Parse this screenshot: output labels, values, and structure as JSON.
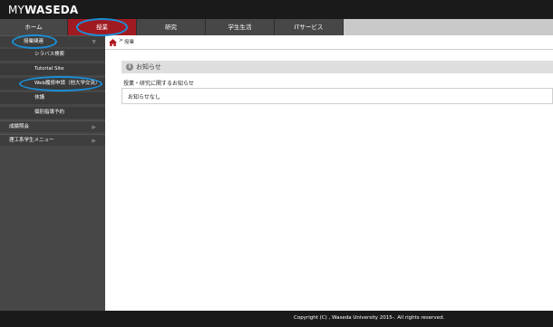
{
  "header": {
    "logo_my": "MY",
    "logo_waseda": "WASEDA"
  },
  "tabs": [
    {
      "label": "ホーム",
      "active": false
    },
    {
      "label": "授業",
      "active": true
    },
    {
      "label": "研究",
      "active": false
    },
    {
      "label": "学生生活",
      "active": false
    },
    {
      "label": "ITサービス",
      "active": false
    }
  ],
  "sidebar": {
    "items": [
      {
        "label": "授業関連",
        "type": "parent",
        "expanded": true
      },
      {
        "label": "シラバス検索",
        "type": "child"
      },
      {
        "label": "Tutorial Site",
        "type": "child"
      },
      {
        "label": "Web履修申請（他大学交流）",
        "type": "child"
      },
      {
        "label": "休講",
        "type": "child"
      },
      {
        "label": "個別指導予約",
        "type": "child"
      },
      {
        "label": "成績照会",
        "type": "parent",
        "expanded": false
      },
      {
        "label": "理工系学生メニュー",
        "type": "parent",
        "expanded": false
      }
    ]
  },
  "breadcrumb": {
    "separator": ">",
    "current": "授業"
  },
  "notice": {
    "icon": "info-icon",
    "title": "お知らせ",
    "subtitle": "授業・研究に関するお知らせ",
    "body": "お知らせなし"
  },
  "footer": {
    "copyright": "Copyright (C) , Waseda University 2015-. All rights reserved."
  },
  "colors": {
    "topbar": "#1a1a1a",
    "tab_active": "#a01a22",
    "tab": "#474747",
    "sidebar": "#474747",
    "annotation_circle": "#1a8fd8"
  }
}
